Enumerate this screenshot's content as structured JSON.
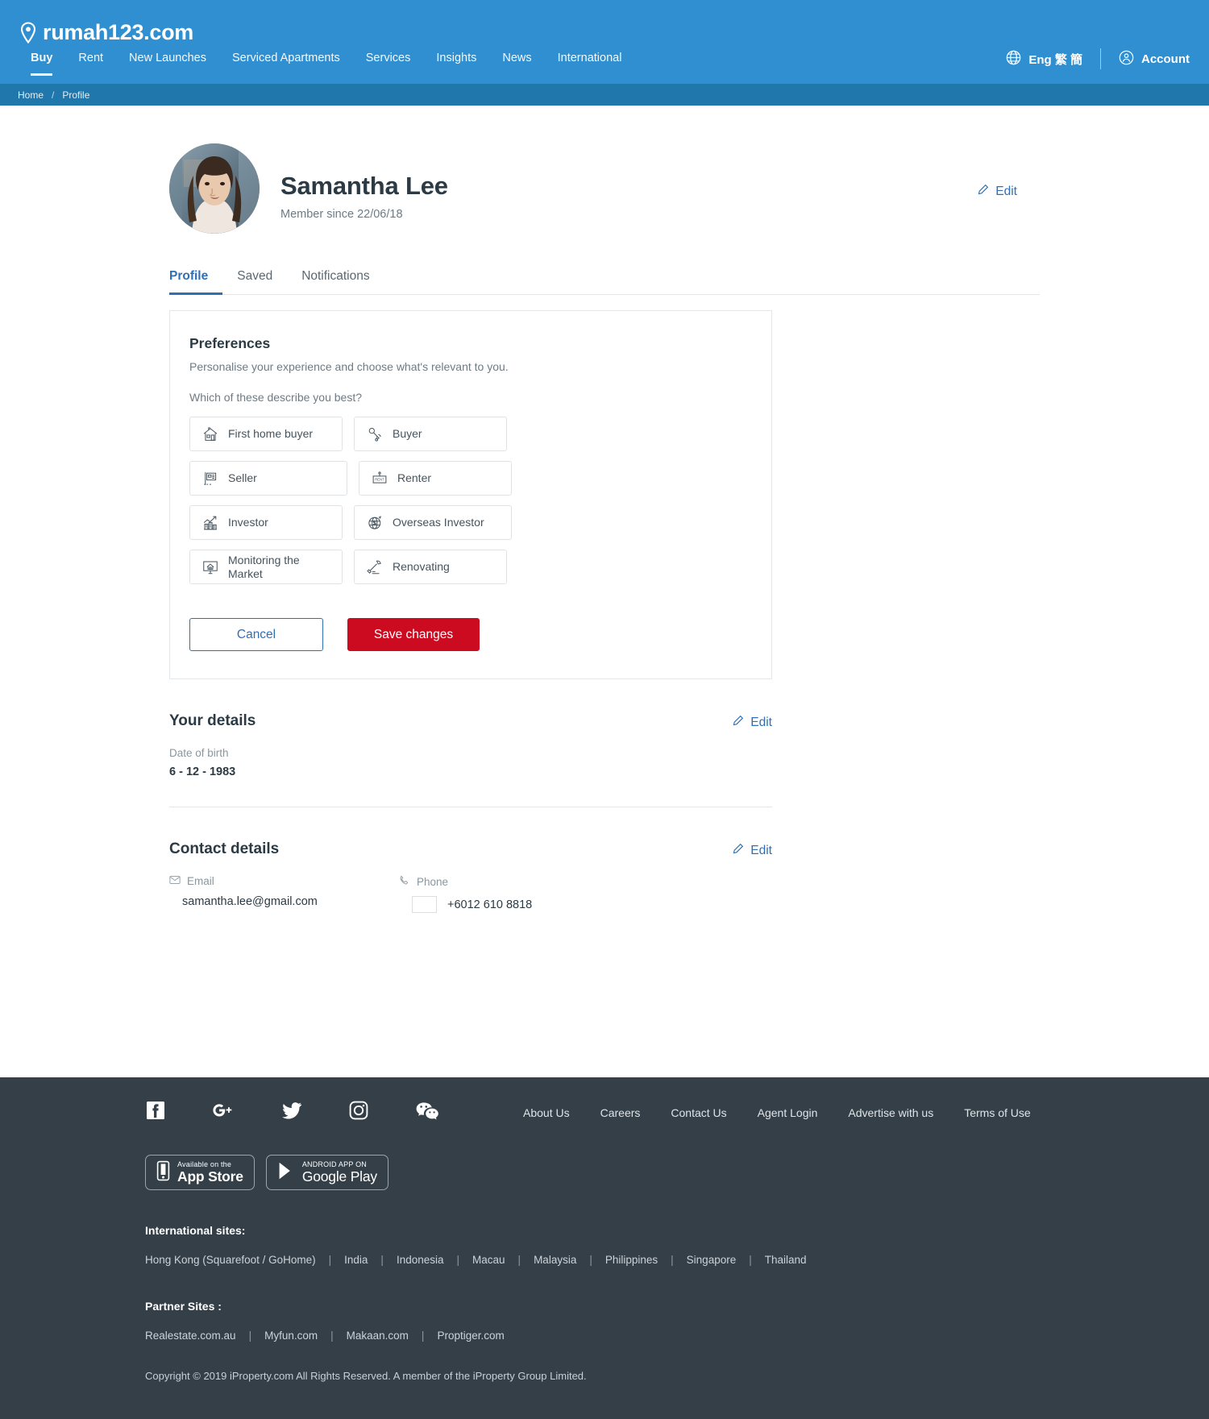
{
  "brand": {
    "name": "rumah123.com",
    "logo_icon": "map-pin-icon",
    "bg_color": "#2f8fd1"
  },
  "nav": {
    "items": [
      {
        "label": "Buy",
        "active": true
      },
      {
        "label": "Rent",
        "active": false
      },
      {
        "label": "New Launches",
        "active": false
      },
      {
        "label": "Serviced Apartments",
        "active": false
      },
      {
        "label": "Services",
        "active": false
      },
      {
        "label": "Insights",
        "active": false
      },
      {
        "label": "News",
        "active": false
      },
      {
        "label": "International",
        "active": false
      }
    ],
    "language": {
      "label": "Eng 繁 簡",
      "icon": "globe-icon"
    },
    "account": {
      "label": "Account",
      "icon": "user-circle-icon"
    }
  },
  "breadcrumb": {
    "items": [
      "Home",
      "Profile"
    ],
    "separator": "/"
  },
  "profile": {
    "name": "Samantha Lee",
    "member_since": "Member since 22/06/18",
    "avatar_alt": "avatar",
    "edit_label": "Edit",
    "edit_icon": "pencil-icon"
  },
  "tabs": [
    {
      "label": "Profile",
      "active": true
    },
    {
      "label": "Saved",
      "active": false
    },
    {
      "label": "Notifications",
      "active": false
    }
  ],
  "preferences": {
    "title": "Preferences",
    "subtitle": "Personalise your experience and choose what's relevant to you.",
    "question": "Which of these describe you best?",
    "options": [
      {
        "label": "First home buyer",
        "icon": "house-icon",
        "selected": false
      },
      {
        "label": "Buyer",
        "icon": "keys-icon",
        "selected": false
      },
      {
        "label": "Seller",
        "icon": "for-sale-sign-icon",
        "selected": false
      },
      {
        "label": "Renter",
        "icon": "rent-sign-icon",
        "selected": false
      },
      {
        "label": "Investor",
        "icon": "growth-chart-building-icon",
        "selected": false
      },
      {
        "label": "Overseas Investor",
        "icon": "globe-dollar-icon",
        "selected": false
      },
      {
        "label": "Monitoring the Market",
        "icon": "monitor-house-icon",
        "selected": false
      },
      {
        "label": "Renovating",
        "icon": "hammer-icon",
        "selected": false
      }
    ],
    "cancel_label": "Cancel",
    "save_label": "Save changes",
    "save_color": "#cc0b20",
    "link_color": "#2f6fb5"
  },
  "your_details": {
    "title": "Your details",
    "edit_label": "Edit",
    "dob_label": "Date of birth",
    "dob_value": "6 - 12 - 1983"
  },
  "contact_details": {
    "title": "Contact details",
    "edit_label": "Edit",
    "email_label": "Email",
    "email_icon": "envelope-icon",
    "email_value": "samantha.lee@gmail.com",
    "phone_label": "Phone",
    "phone_icon": "phone-icon",
    "phone_value": "+6012 610 8818",
    "phone_flag": "indonesia-flag"
  },
  "footer": {
    "bg_color": "#343f48",
    "socials": [
      {
        "name": "facebook-icon"
      },
      {
        "name": "google-plus-icon"
      },
      {
        "name": "twitter-icon"
      },
      {
        "name": "instagram-icon"
      },
      {
        "name": "wechat-icon"
      }
    ],
    "links": [
      "About Us",
      "Careers",
      "Contact Us",
      "Agent Login",
      "Advertise with us",
      "Terms of Use"
    ],
    "stores": [
      {
        "small": "Available on the",
        "big": "App Store",
        "icon": "apple-phone-icon"
      },
      {
        "small": "ANDROID APP ON",
        "big": "Google Play",
        "icon": "google-play-icon"
      }
    ],
    "international_heading": "International sites:",
    "international_sites": [
      "Hong Kong  (Squarefoot / GoHome)",
      "India",
      "Indonesia",
      "Macau",
      "Malaysia",
      "Philippines",
      "Singapore",
      "Thailand"
    ],
    "partner_heading": "Partner Sites :",
    "partner_sites": [
      "Realestate.com.au",
      "Myfun.com",
      "Makaan.com",
      "Proptiger.com"
    ],
    "copyright": "Copyright © 2019 iProperty.com All Rights Reserved. A member of the iProperty Group Limited."
  }
}
